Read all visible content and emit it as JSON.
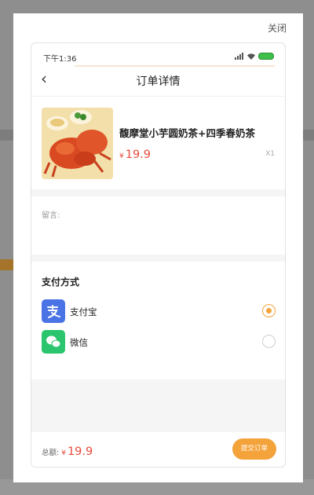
{
  "modal": {
    "close_label": "关闭"
  },
  "statusbar": {
    "time": "下午1:36"
  },
  "nav": {
    "title": "订单详情"
  },
  "product": {
    "name": "馥摩堂小芋圆奶茶+四季春奶茶",
    "currency": "¥",
    "price": "19.9",
    "quantity": "X1"
  },
  "remark": {
    "label": "留言:"
  },
  "payment": {
    "title": "支付方式",
    "methods": [
      {
        "name": "支付宝",
        "icon": "alipay-icon",
        "selected": true
      },
      {
        "name": "微信",
        "icon": "wechat-icon",
        "selected": false
      }
    ]
  },
  "footer": {
    "total_label": "总额:",
    "currency": "¥",
    "total": "19.9",
    "submit_label": "提交订单"
  },
  "colors": {
    "accent": "#f4a23a",
    "price": "#e8493b",
    "alipay": "#4a73e6",
    "wechat": "#2bc56e"
  }
}
